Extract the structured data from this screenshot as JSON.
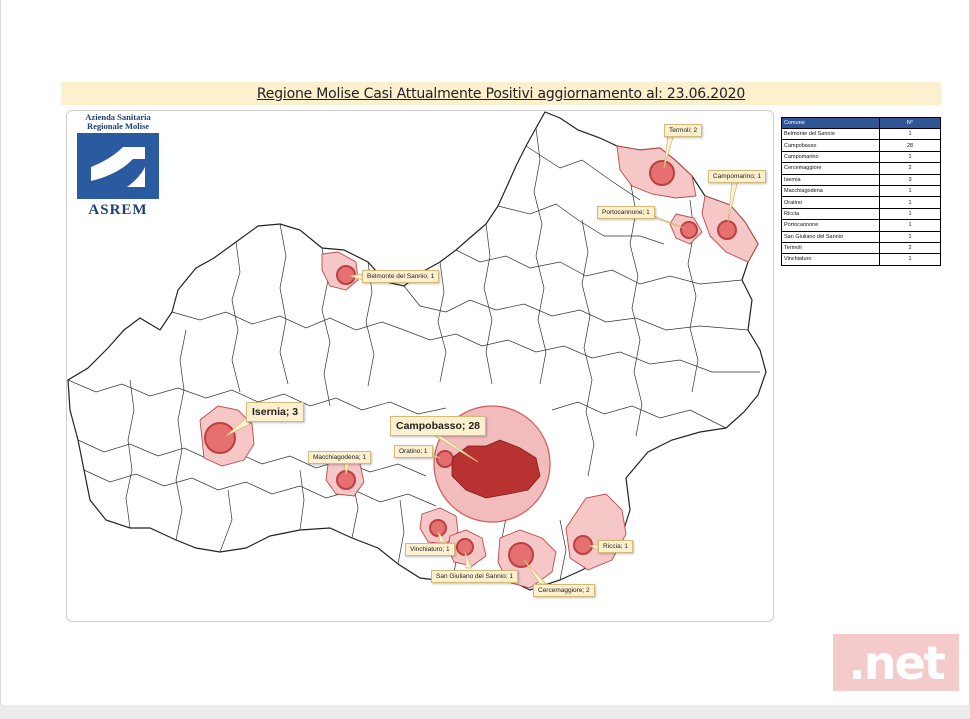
{
  "title": "Regione Molise Casi Attualmente Positivi aggiornamento al: 23.06.2020",
  "logo": {
    "line1": "Azienda Sanitaria",
    "line2": "Regionale Molise",
    "acronym": "ASREM"
  },
  "colors": {
    "highlight_fill": "#f5c7c7",
    "circle_fill": "#e05a5a",
    "circle_stroke": "#c0392b",
    "campobasso_fill": "#c0392b",
    "callout_bg": "#fdf0cf",
    "table_header": "#2f5597"
  },
  "map_labels": [
    {
      "id": "termoli",
      "text": "Termoli; 2",
      "cases": 2
    },
    {
      "id": "campomarino",
      "text": "Campomarino; 1",
      "cases": 1
    },
    {
      "id": "portocannone",
      "text": "Portocannone; 1",
      "cases": 1
    },
    {
      "id": "belmonte",
      "text": "Belmonte del Sannio; 1",
      "cases": 1
    },
    {
      "id": "isernia",
      "text": "Isernia; 3",
      "cases": 3
    },
    {
      "id": "campobasso",
      "text": "Campobasso; 28",
      "cases": 28
    },
    {
      "id": "oratino",
      "text": "Oratino; 1",
      "cases": 1
    },
    {
      "id": "macchiagodena",
      "text": "Macchiagodena; 1",
      "cases": 1
    },
    {
      "id": "vinchiaturo",
      "text": "Vinchiaturo; 1",
      "cases": 1
    },
    {
      "id": "sangiuliano",
      "text": "San Giuliano del Sannio; 1",
      "cases": 1
    },
    {
      "id": "cercemaggiore",
      "text": "Cercemaggiore; 2",
      "cases": 2
    },
    {
      "id": "riccia",
      "text": "Riccia; 1",
      "cases": 1
    }
  ],
  "table": {
    "headers": [
      "Comune",
      "N°"
    ],
    "rows": [
      [
        "Belmonte del Sannio",
        "1"
      ],
      [
        "Campobasso",
        "28"
      ],
      [
        "Campomarino",
        "1"
      ],
      [
        "Cercemaggiore",
        "2"
      ],
      [
        "Isernia",
        "3"
      ],
      [
        "Macchiagodena",
        "1"
      ],
      [
        "Oratino",
        "1"
      ],
      [
        "Riccia",
        "1"
      ],
      [
        "Portocannone",
        "1"
      ],
      [
        "San Giuliano del Sannio",
        "1"
      ],
      [
        "Termoli",
        "2"
      ],
      [
        "Vinchiaturo",
        "1"
      ]
    ]
  },
  "watermark": ".net"
}
